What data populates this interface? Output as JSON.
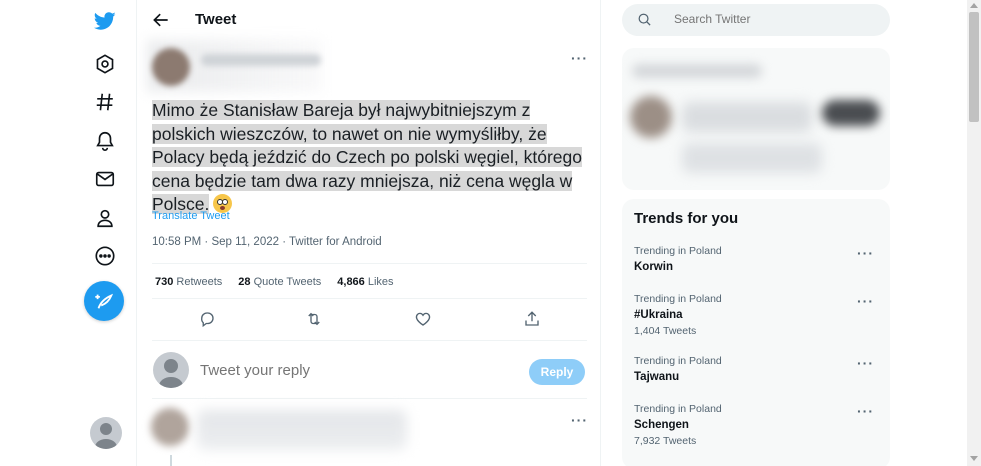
{
  "topbar": {
    "title": "Tweet"
  },
  "tweet": {
    "lines": [
      "Mimo że Stanisław Bareja był najwybitniejszym z",
      "polskich wieszczów, to nawet on nie wymyśliłby, że",
      "Polacy będą jeździć do Czech po polski węgiel, którego",
      "cena będzie tam dwa razy mniejsza, niż cena węgla w",
      "Polsce."
    ],
    "emoji": "flushed-face-emoji",
    "translate_label": "Translate Tweet",
    "meta": "10:58 PM · Sep 11, 2022 · Twitter for Android",
    "stats": {
      "retweets_count": "730",
      "retweets_label": "Retweets",
      "quotes_count": "28",
      "quotes_label": "Quote Tweets",
      "likes_count": "4,866",
      "likes_label": "Likes"
    },
    "more_label": "···"
  },
  "reply": {
    "placeholder": "Tweet your reply",
    "button_label": "Reply"
  },
  "search": {
    "placeholder": "Search Twitter"
  },
  "trends": {
    "title": "Trends for you",
    "items": [
      {
        "context": "Trending in Poland",
        "name": "Korwin",
        "count": ""
      },
      {
        "context": "Trending in Poland",
        "name": "#Ukraina",
        "count": "1,404 Tweets"
      },
      {
        "context": "Trending in Poland",
        "name": "Tajwanu",
        "count": ""
      },
      {
        "context": "Trending in Poland",
        "name": "Schengen",
        "count": "7,932 Tweets"
      }
    ]
  },
  "colors": {
    "accent": "#1d9bf0",
    "reply_button_disabled": "#8ecdf8",
    "text_secondary": "#536471",
    "highlight": "#d8d8d8"
  },
  "icons": {
    "logo": "twitter-bird-icon",
    "nav": [
      "explore-icon",
      "hashtag-icon",
      "bell-icon",
      "mail-icon",
      "profile-icon",
      "more-circle-icon"
    ],
    "compose": "compose-tweet-icon",
    "actions": [
      "reply-icon",
      "retweet-icon",
      "like-icon",
      "share-icon"
    ]
  }
}
